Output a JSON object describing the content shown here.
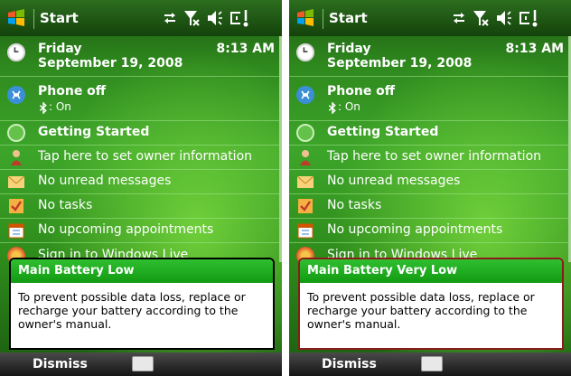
{
  "screens": [
    {
      "title": "Start",
      "date_day": "Friday",
      "date_full": "September 19, 2008",
      "time": "8:13 AM",
      "phone_status": "Phone off",
      "bluetooth_status": ": On",
      "getting_started": "Getting Started",
      "owner_info": "Tap here to set owner information",
      "messages": "No unread messages",
      "tasks": "No tasks",
      "appointments": "No upcoming appointments",
      "windows_live": "Sign in to Windows Live",
      "popup_title": "Main Battery Low",
      "popup_text": "To prevent possible data loss, replace or recharge your battery according to the owner's manual.",
      "softkey": "Dismiss",
      "popup_border_color": "#000000"
    },
    {
      "title": "Start",
      "date_day": "Friday",
      "date_full": "September 19, 2008",
      "time": "8:13 AM",
      "phone_status": "Phone off",
      "bluetooth_status": ": On",
      "getting_started": "Getting Started",
      "owner_info": "Tap here to set owner information",
      "messages": "No unread messages",
      "tasks": "No tasks",
      "appointments": "No upcoming appointments",
      "windows_live": "Sign in to Windows Live",
      "popup_title": "Main Battery Very Low",
      "popup_text": "To prevent possible data loss, replace or recharge your battery according to the owner's manual.",
      "softkey": "Dismiss",
      "popup_border_color": "#8b1a1a"
    }
  ],
  "icons": {
    "start": "windows-flag-icon",
    "clock": "clock-icon",
    "phone": "phone-icon",
    "bluetooth": "bluetooth-icon",
    "getting_started": "getting-started-icon",
    "owner": "owner-icon",
    "messages": "envelope-icon",
    "tasks": "task-icon",
    "calendar": "calendar-icon",
    "windows_live": "windows-live-icon",
    "keyboard": "keyboard-icon"
  },
  "colors": {
    "accent_green": "#129a12",
    "titlebar": "#14420b"
  }
}
